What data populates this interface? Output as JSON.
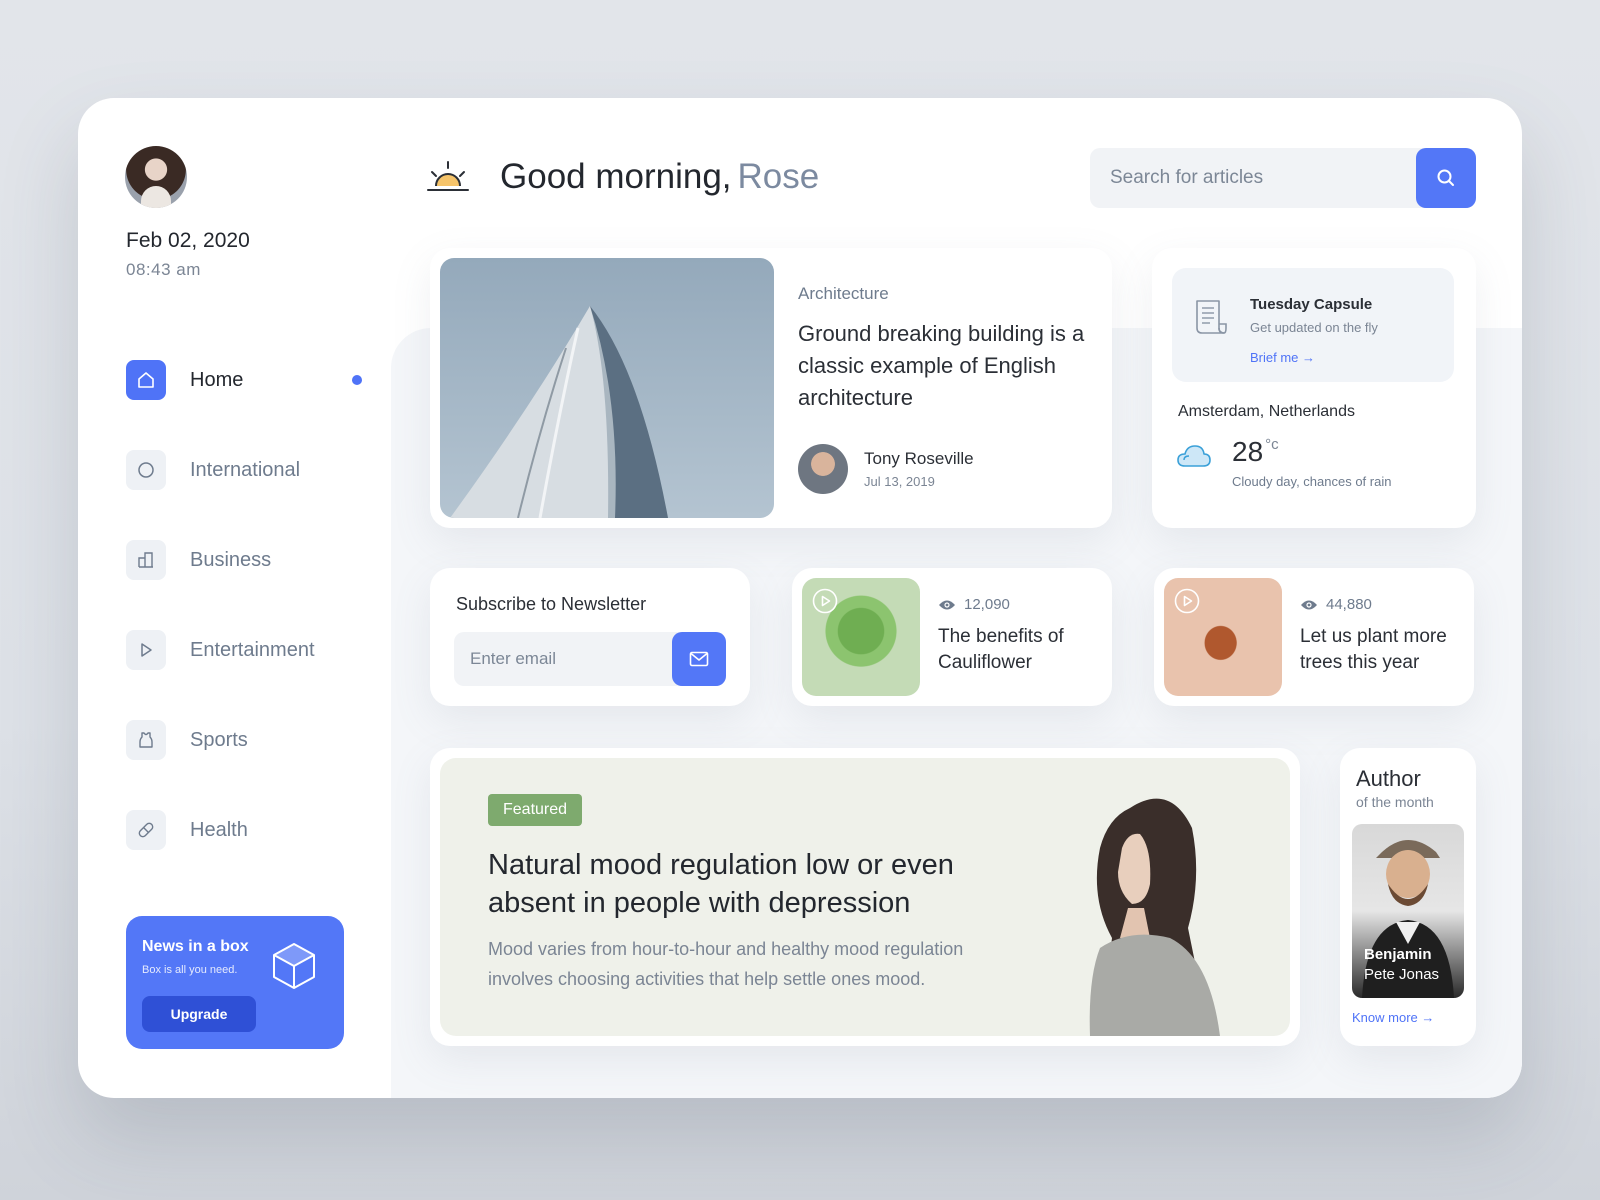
{
  "sidebar": {
    "date": "Feb 02, 2020",
    "time": "08:43 am",
    "nav": [
      {
        "label": "Home",
        "icon": "home-icon",
        "active": true
      },
      {
        "label": "International",
        "icon": "circle-icon",
        "active": false
      },
      {
        "label": "Business",
        "icon": "building-icon",
        "active": false
      },
      {
        "label": "Entertainment",
        "icon": "play-icon",
        "active": false
      },
      {
        "label": "Sports",
        "icon": "jersey-icon",
        "active": false
      },
      {
        "label": "Health",
        "icon": "pill-icon",
        "active": false
      }
    ],
    "promo": {
      "title": "News in a box",
      "subtitle": "Box is all you need.",
      "button": "Upgrade"
    }
  },
  "header": {
    "greeting": "Good morning,",
    "name": "Rose",
    "search_placeholder": "Search for articles"
  },
  "article": {
    "category": "Architecture",
    "title": "Ground breaking building is a classic example of English architecture",
    "author": "Tony Roseville",
    "date": "Jul 13, 2019"
  },
  "capsule": {
    "title": "Tuesday Capsule",
    "subtitle": "Get updated on the fly",
    "link": "Brief me"
  },
  "weather": {
    "city": "Amsterdam, Netherlands",
    "temperature": "28",
    "unit": "°c",
    "description": "Cloudy day, chances of rain"
  },
  "newsletter": {
    "title": "Subscribe to Newsletter",
    "placeholder": "Enter email"
  },
  "videos": [
    {
      "views": "12,090",
      "title": "The benefits of Cauliflower"
    },
    {
      "views": "44,880",
      "title": "Let us plant more trees this year"
    }
  ],
  "featured": {
    "badge": "Featured",
    "title": "Natural mood regulation low or even absent in people with depression",
    "description": "Mood varies from hour-to-hour and healthy mood regulation involves choosing activities that help settle ones mood."
  },
  "author_of_month": {
    "title": "Author",
    "subtitle": "of the month",
    "first_name": "Benjamin",
    "last_name": "Pete Jonas",
    "link": "Know more"
  },
  "colors": {
    "accent": "#5377f7",
    "featured_badge": "#7eaa6e",
    "featured_bg": "#eff1ea"
  }
}
